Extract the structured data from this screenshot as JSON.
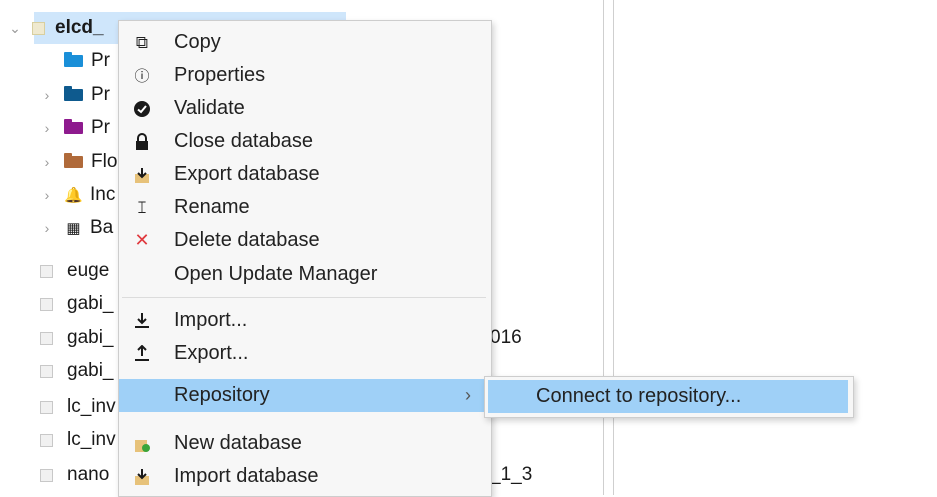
{
  "tree": {
    "root": {
      "label": "elcd_",
      "expanded_arrow": "⌄"
    },
    "children": [
      {
        "label": "Pr",
        "icon": "folder",
        "color": "#1a8fd8",
        "has_arrow": false
      },
      {
        "label": "Pr",
        "icon": "folder",
        "color": "#0e5a8e",
        "has_arrow": true
      },
      {
        "label": "Pr",
        "icon": "folder",
        "color": "#8e1a8e",
        "has_arrow": true
      },
      {
        "label": "Flo",
        "icon": "folder",
        "color": "#b06a3a",
        "has_arrow": true
      },
      {
        "label": "Inc",
        "icon": "bell-icon",
        "has_arrow": true
      },
      {
        "label": "Ba",
        "icon": "grid-icon",
        "has_arrow": true
      }
    ],
    "databases": [
      {
        "label": "euge",
        "suffix": ""
      },
      {
        "label": "gabi_",
        "suffix": ""
      },
      {
        "label": "gabi_",
        "suffix": "016"
      },
      {
        "label": "gabi_",
        "suffix": ""
      },
      {
        "label": "lc_inv",
        "suffix": ""
      },
      {
        "label": "lc_inv",
        "suffix": ""
      },
      {
        "label": "nano",
        "suffix": "_1_3"
      }
    ]
  },
  "context_menu": {
    "items": [
      {
        "label": "Copy",
        "icon": "copy-icon"
      },
      {
        "label": "Properties",
        "icon": "info-icon"
      },
      {
        "label": "Validate",
        "icon": "check-circle-icon"
      },
      {
        "label": "Close database",
        "icon": "lock-icon"
      },
      {
        "label": "Export database",
        "icon": "export-database-icon"
      },
      {
        "label": "Rename",
        "icon": "rename-icon"
      },
      {
        "label": "Delete database",
        "icon": "delete-icon"
      },
      {
        "label": "Open Update Manager",
        "icon": ""
      },
      {
        "label": "Import...",
        "icon": "import-icon"
      },
      {
        "label": "Export...",
        "icon": "export-icon"
      },
      {
        "label": "Repository",
        "icon": "",
        "submenu_arrow": "›"
      },
      {
        "label": "New database",
        "icon": "new-database-icon"
      },
      {
        "label": "Import database",
        "icon": "import-database-icon"
      }
    ]
  },
  "submenu": {
    "items": [
      {
        "label": "Connect to repository..."
      }
    ]
  },
  "colors": {
    "highlight": "#9fd0f7",
    "selection": "#cfe6fb",
    "delete": "#e0393e"
  }
}
